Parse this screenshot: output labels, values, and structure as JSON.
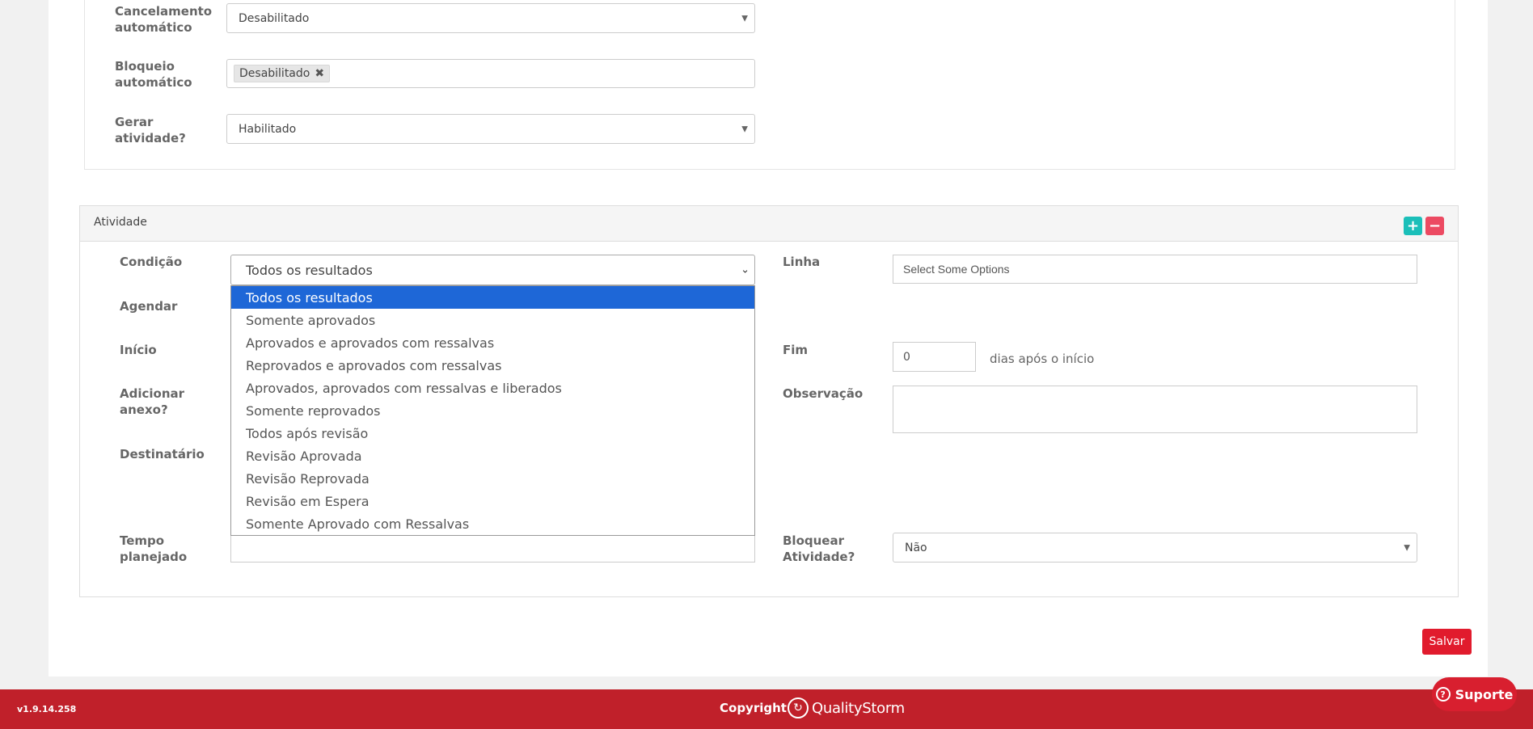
{
  "top_form": {
    "cancelamento": {
      "label_line1": "Cancelamento",
      "label_line2": "automático",
      "value": "Desabilitado"
    },
    "bloqueio": {
      "label_line1": "Bloqueio",
      "label_line2": "automático",
      "tag": "Desabilitado"
    },
    "gerar": {
      "label_line1": "Gerar",
      "label_line2": "atividade?",
      "value": "Habilitado"
    }
  },
  "atividade": {
    "title": "Atividade",
    "plus_label": "+",
    "minus_label": "−",
    "condicao": {
      "label": "Condição",
      "value": "Todos os resultados"
    },
    "condicao_options": [
      "Todos os resultados",
      "Somente aprovados",
      "Aprovados e aprovados com ressalvas",
      "Reprovados e aprovados com ressalvas",
      "Aprovados, aprovados com ressalvas e liberados",
      "Somente reprovados",
      "Todos após revisão",
      "Revisão Aprovada",
      "Revisão Reprovada",
      "Revisão em Espera",
      "Somente Aprovado com Ressalvas"
    ],
    "agendar_label": "Agendar",
    "inicio_label": "Início",
    "anexo": {
      "label_line1": "Adicionar",
      "label_line2": "anexo?"
    },
    "destinatario_label": "Destinatário",
    "tempo": {
      "label_line1": "Tempo",
      "label_line2": "planejado"
    },
    "linha": {
      "label": "Linha",
      "placeholder": "Select Some Options"
    },
    "fim": {
      "label": "Fim",
      "value": "0",
      "suffix": "dias após o início"
    },
    "observacao_label": "Observação",
    "bloquear": {
      "label_line1": "Bloquear",
      "label_line2": "Atividade?",
      "value": "Não"
    }
  },
  "save_label": "Salvar",
  "footer": {
    "version": "v1.9.14.258",
    "copyright": "Copyright",
    "brand": "QualityStorm",
    "support": "Suporte"
  },
  "colors": {
    "footer": "#c0202a",
    "accent_blue": "#1e67d7",
    "save": "#e11b2d",
    "plus": "#1bbfb9",
    "minus": "#ec4a62"
  }
}
